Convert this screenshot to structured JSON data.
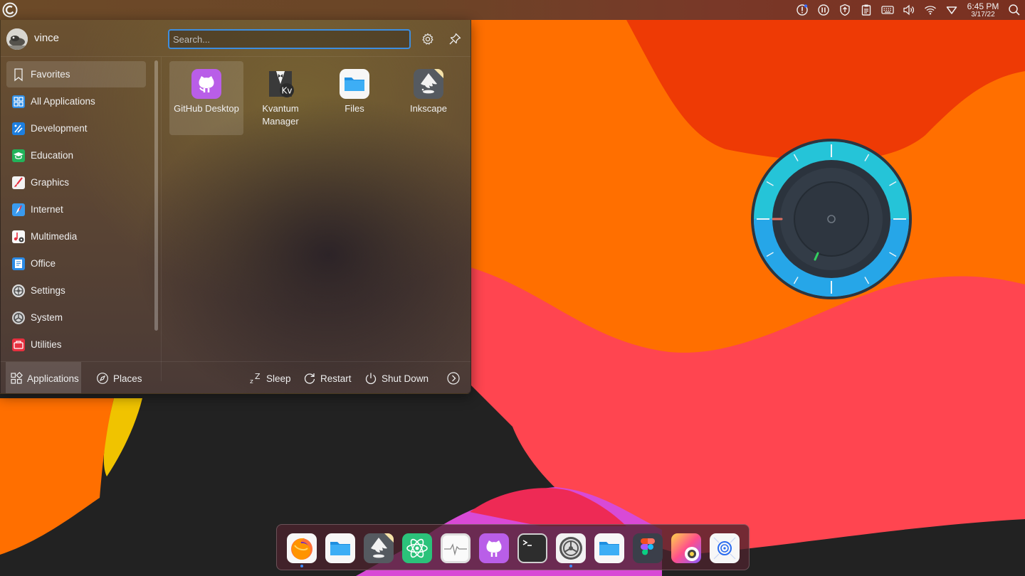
{
  "top_panel": {
    "launcher_icon": "kde-application-launcher-icon",
    "tray_icons": [
      "notification-alert-icon",
      "media-pause-icon",
      "updates-shield-icon",
      "clipboard-icon",
      "keyboard-layout-icon",
      "volume-icon",
      "wifi-icon",
      "network-vpn-icon"
    ],
    "clock_time": "6:45 PM",
    "clock_date": "3/17/22",
    "search_icon": "search-icon"
  },
  "launcher": {
    "username": "vince",
    "search_placeholder": "Search...",
    "categories": [
      {
        "label": "Favorites",
        "icon": "bookmark-icon"
      },
      {
        "label": "All Applications",
        "icon": "grid-apps-icon"
      },
      {
        "label": "Development",
        "icon": "development-icon"
      },
      {
        "label": "Education",
        "icon": "education-icon"
      },
      {
        "label": "Graphics",
        "icon": "graphics-icon"
      },
      {
        "label": "Internet",
        "icon": "internet-icon"
      },
      {
        "label": "Multimedia",
        "icon": "multimedia-icon"
      },
      {
        "label": "Office",
        "icon": "office-icon"
      },
      {
        "label": "Settings",
        "icon": "settings-icon"
      },
      {
        "label": "System",
        "icon": "system-icon"
      },
      {
        "label": "Utilities",
        "icon": "utilities-icon"
      }
    ],
    "apps": [
      {
        "name": "GitHub Desktop",
        "icon": "github-desktop-icon"
      },
      {
        "name": "Kvantum Manager",
        "icon": "kvantum-manager-icon",
        "badge": "Kv"
      },
      {
        "name": "Files",
        "icon": "files-icon"
      },
      {
        "name": "Inkscape",
        "icon": "inkscape-icon"
      }
    ],
    "footer": {
      "applications": "Applications",
      "places": "Places",
      "sleep": "Sleep",
      "restart": "Restart",
      "shutdown": "Shut Down"
    }
  },
  "dock": {
    "items": [
      {
        "name": "firefox",
        "running": true
      },
      {
        "name": "files",
        "running": false
      },
      {
        "name": "inkscape",
        "running": false
      },
      {
        "name": "atom",
        "running": false
      },
      {
        "name": "system-monitor",
        "running": false
      },
      {
        "name": "github-desktop",
        "running": false
      },
      {
        "name": "terminal",
        "running": false
      },
      {
        "name": "system-settings",
        "running": true
      },
      {
        "name": "files-2",
        "running": false
      },
      {
        "name": "figma",
        "running": false
      },
      {
        "name": "color-picker",
        "running": false
      },
      {
        "name": "network-browser",
        "running": false
      }
    ]
  },
  "colors": {
    "accent": "#3d8ee0",
    "wallpaper_orange": "#ff6d00",
    "wallpaper_red": "#ff4550",
    "wallpaper_dark": "#202020"
  }
}
